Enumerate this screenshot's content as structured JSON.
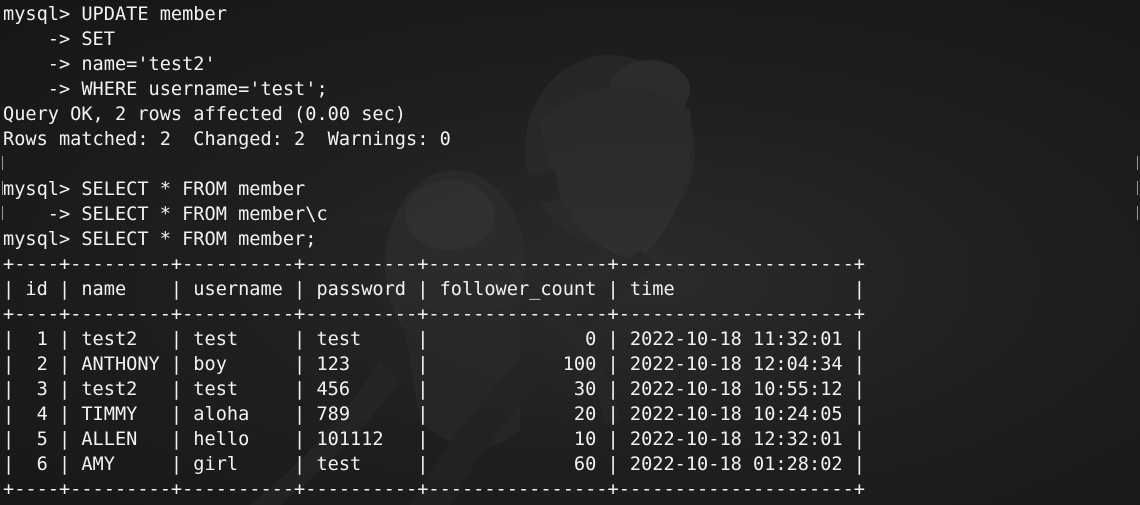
{
  "terminal": {
    "lines": [
      "mysql> UPDATE member",
      "    -> SET",
      "    -> name='test2'",
      "    -> WHERE username='test';",
      "Query OK, 2 rows affected (0.00 sec)",
      "Rows matched: 2  Changed: 2  Warnings: 0",
      "",
      "mysql> SELECT * FROM member",
      "    -> SELECT * FROM member\\c",
      "mysql> SELECT * FROM member;",
      "+----+---------+----------+----------+----------------+---------------------+",
      "| id | name    | username | password | follower_count | time                |",
      "+----+---------+----------+----------+----------------+---------------------+",
      "|  1 | test2   | test     | test     |              0 | 2022-10-18 11:32:01 |",
      "|  2 | ANTHONY | boy      | 123      |            100 | 2022-10-18 12:04:34 |",
      "|  3 | test2   | test     | 456      |             30 | 2022-10-18 10:55:12 |",
      "|  4 | TIMMY   | aloha    | 789      |             20 | 2022-10-18 10:24:05 |",
      "|  5 | ALLEN   | hello    | 101112   |             10 | 2022-10-18 12:32:01 |",
      "|  6 | AMY     | girl     | test     |             60 | 2022-10-18 01:28:02 |",
      "+----+---------+----------+----------+----------------+---------------------+"
    ]
  },
  "colors": {
    "background": "#1b1b1b",
    "text": "#f2f2f2"
  },
  "background_image": "sparrows-on-branch"
}
